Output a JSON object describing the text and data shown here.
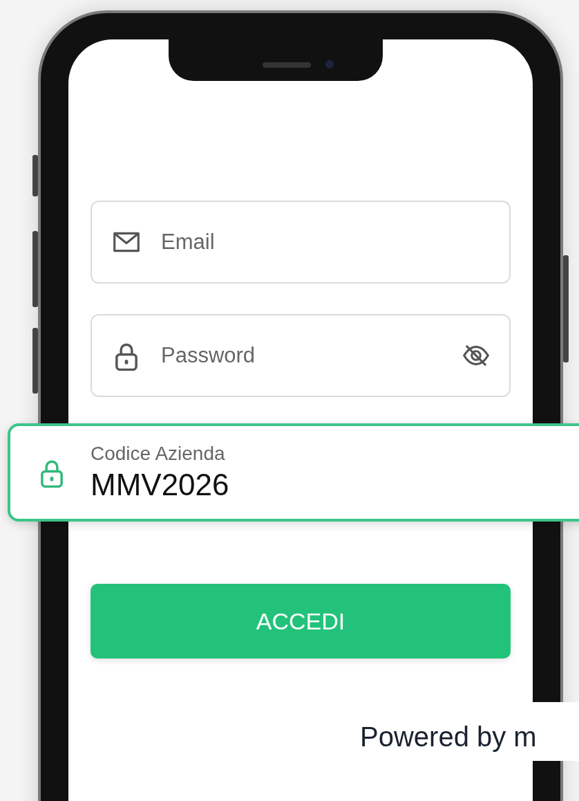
{
  "fields": [
    {
      "kind": "email",
      "placeholder": "Email"
    },
    {
      "kind": "password",
      "placeholder": "Password"
    }
  ],
  "company_code": {
    "label": "Codice Azienda",
    "value": "MMV2026"
  },
  "submit": {
    "label": "ACCEDI"
  },
  "footer": {
    "text": "Powered by m"
  }
}
